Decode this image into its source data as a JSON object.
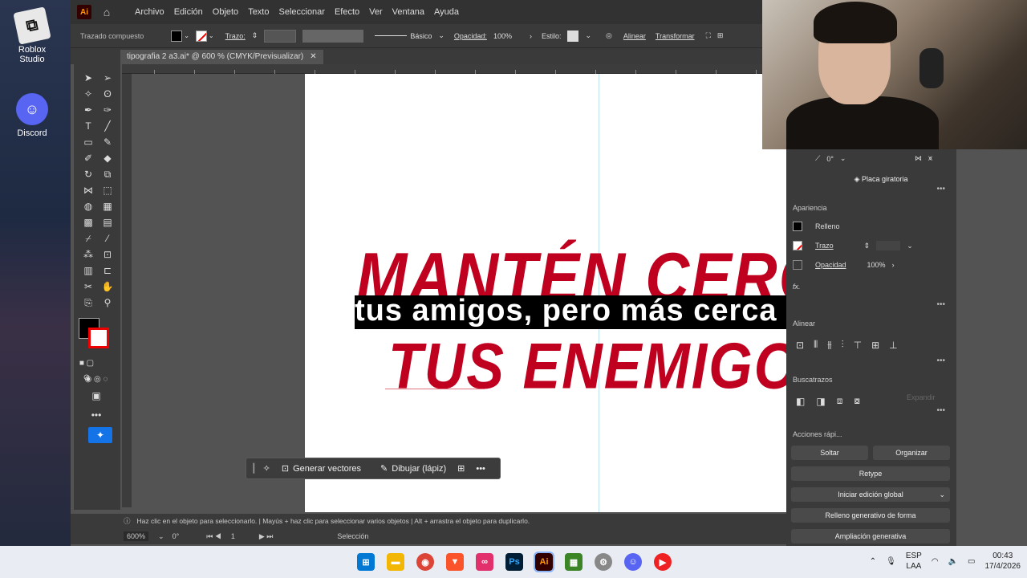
{
  "desktop": {
    "icons": [
      {
        "label": "Roblox Studio",
        "icon": "roblox-icon"
      },
      {
        "label": "Discord",
        "icon": "discord-icon"
      }
    ]
  },
  "menubar": {
    "items": [
      "Archivo",
      "Edición",
      "Objeto",
      "Texto",
      "Seleccionar",
      "Efecto",
      "Ver",
      "Ventana",
      "Ayuda"
    ]
  },
  "controlbar": {
    "object_type": "Trazado compuesto",
    "stroke_label": "Trazo:",
    "brush_label": "Básico",
    "opacity_label": "Opacidad:",
    "opacity_value": "100%",
    "style_label": "Estilo:",
    "align_label": "Alinear",
    "transform_label": "Transformar"
  },
  "document": {
    "tab_title": "tipografia 2 a3.ai* @ 600 % (CMYK/Previsualizar)",
    "close": "✕"
  },
  "artwork": {
    "line1": "MANTÉN CERCA A",
    "line2": "tus amigos,  pero más cerca",
    "line3": "TUS ENEMIGOS.",
    "red_color": "#c0001f"
  },
  "context_bar": {
    "generate": "Generar vectores",
    "draw": "Dibujar (lápiz)",
    "more": "•••"
  },
  "statusbar": {
    "hint": "Haz clic en el objeto para seleccionarlo. | Mayús + haz clic para seleccionar varios objetos | Alt + arrastra el objeto para duplicarlo.",
    "zoom": "600%",
    "rotation": "0°",
    "artboard": "1",
    "tool": "Selección"
  },
  "panel": {
    "angle": "0°",
    "placa": "Placa giratoria",
    "apariencia": "Apariencia",
    "relleno": "Relleno",
    "trazo": "Trazo",
    "opacidad": "Opacidad",
    "opacidad_value": "100%",
    "fx": "fx.",
    "alinear": "Alinear",
    "buscatrazos": "Buscatrazos",
    "expandir": "Expandir",
    "acciones": "Acciones rápi...",
    "soltar": "Soltar",
    "organizar": "Organizar",
    "retype": "Retype",
    "iniciar": "Iniciar edición global",
    "relleno_gen": "Relleno generativo de forma",
    "ampliacion": "Ampliación generativa"
  },
  "taskbar": {
    "lang": "ESP",
    "lang2": "LAA",
    "time": "00:43",
    "date": "17/4/2026",
    "ps_label": "Ps",
    "ai_label": "Ai"
  }
}
